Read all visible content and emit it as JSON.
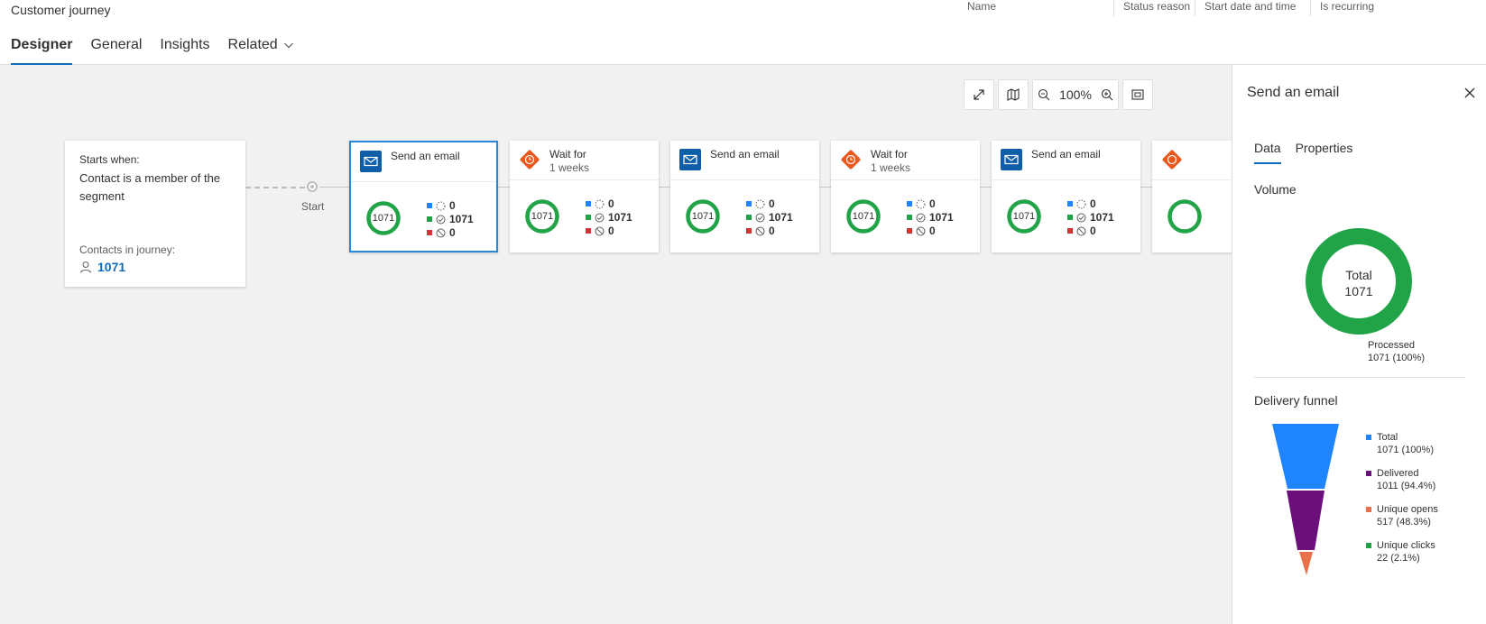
{
  "header": {
    "title": "Customer journey",
    "columns": [
      "Name",
      "Status reason",
      "Start date and time",
      "Is recurring"
    ]
  },
  "tabs": [
    {
      "label": "Designer"
    },
    {
      "label": "General"
    },
    {
      "label": "Insights"
    },
    {
      "label": "Related"
    }
  ],
  "toolbar": {
    "zoom": "100%"
  },
  "start_card": {
    "label": "Starts when:",
    "condition": "Contact is a member of the segment",
    "contacts_label": "Contacts in journey:",
    "contacts_count": "1071"
  },
  "start_label": "Start",
  "tiles": [
    {
      "type": "email",
      "title": "Send an email",
      "subtitle": "",
      "ring": "1071",
      "pending": "0",
      "processed": "1071",
      "blocked": "0"
    },
    {
      "type": "wait",
      "title": "Wait for",
      "subtitle": "1 weeks",
      "ring": "1071",
      "pending": "0",
      "processed": "1071",
      "blocked": "0"
    },
    {
      "type": "email",
      "title": "Send an email",
      "subtitle": "",
      "ring": "1071",
      "pending": "0",
      "processed": "1071",
      "blocked": "0"
    },
    {
      "type": "wait",
      "title": "Wait for",
      "subtitle": "1 weeks",
      "ring": "1071",
      "pending": "0",
      "processed": "1071",
      "blocked": "0"
    },
    {
      "type": "email",
      "title": "Send an email",
      "subtitle": "",
      "ring": "1071",
      "pending": "0",
      "processed": "1071",
      "blocked": "0"
    }
  ],
  "panel": {
    "title": "Send an email",
    "tabs": [
      "Data",
      "Properties"
    ],
    "volume_title": "Volume",
    "donut_label": "Total",
    "donut_value": "1071",
    "processed_label": "Processed",
    "processed_value": "1071 (100%)",
    "funnel_title": "Delivery funnel",
    "funnel": [
      {
        "name": "Total",
        "value": "1071 (100%)",
        "color": "#1f85ff"
      },
      {
        "name": "Delivered",
        "value": "1011 (94.4%)",
        "color": "#6b0f7a"
      },
      {
        "name": "Unique opens",
        "value": "517 (48.3%)",
        "color": "#e8704a"
      },
      {
        "name": "Unique clicks",
        "value": "22 (2.1%)",
        "color": "#21a348"
      }
    ]
  },
  "colors": {
    "accent": "#0f6cbd",
    "email_icon": "#0f5fa8",
    "wait_icon": "#e8581c",
    "ring": "#21a348"
  }
}
